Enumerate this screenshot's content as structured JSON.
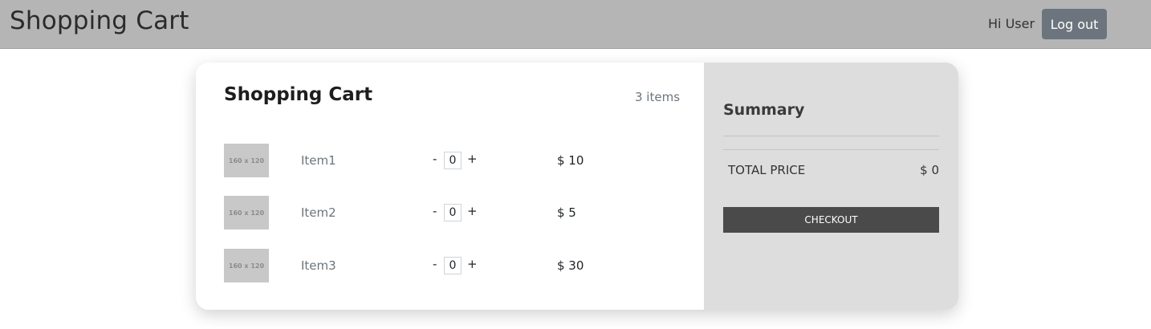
{
  "header": {
    "brand": "Shopping Cart",
    "greeting": "Hi User",
    "logout_label": "Log out"
  },
  "cart": {
    "title": "Shopping Cart",
    "item_count": "3 items",
    "items": [
      {
        "thumb_label": "160 x 120",
        "name": "Item1",
        "minus": "-",
        "quantity": "0",
        "plus": "+",
        "price": "$ 10"
      },
      {
        "thumb_label": "160 x 120",
        "name": "Item2",
        "minus": "-",
        "quantity": "0",
        "plus": "+",
        "price": "$ 5"
      },
      {
        "thumb_label": "160 x 120",
        "name": "Item3",
        "minus": "-",
        "quantity": "0",
        "plus": "+",
        "price": "$ 30"
      }
    ]
  },
  "summary": {
    "title": "Summary",
    "total_label": "TOTAL PRICE",
    "total_value": "$ 0",
    "checkout_label": "CHECKOUT"
  },
  "colors": {
    "header_bg": "#b5b5b5",
    "logout_bg": "#6c757d",
    "summary_bg": "#dddddd",
    "checkout_bg": "#4a4a4a",
    "thumb_bg": "#c8c8c8"
  }
}
